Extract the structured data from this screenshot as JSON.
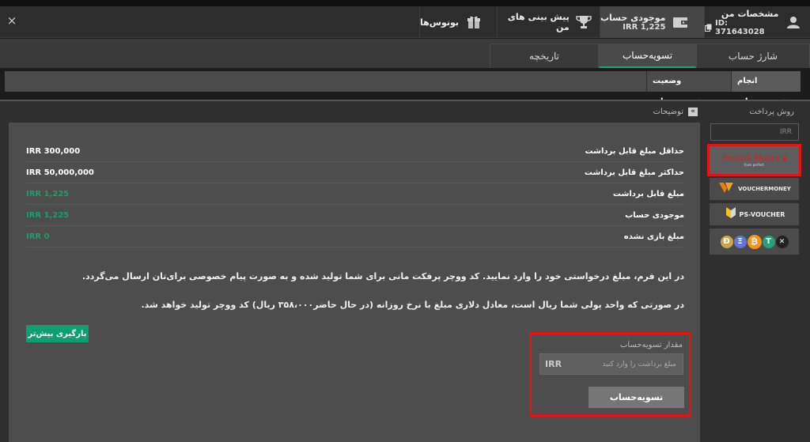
{
  "header": {
    "close_glyph": "×",
    "profile": {
      "title": "مشخصات من",
      "id": "ID: 371643028"
    },
    "balance": {
      "title": "موجودی حساب",
      "amount": "IRR 1,225"
    },
    "predictions": {
      "title": "پیش بینی های من"
    },
    "bonuses": {
      "title": "بونوس‌ها"
    }
  },
  "subtabs": {
    "charge": "شارژ حساب",
    "settle": "تسویه‌حساب",
    "history": "تاریخچه"
  },
  "tabs3": {
    "do_settle": "انجام تسویه‌حساب",
    "status": "وضعیت تسویه‌حساب"
  },
  "payment": {
    "label": "روش پرداخت",
    "currency_field": "IRR",
    "methods": [
      {
        "name": "Perfect Money",
        "tagline": "lives perfect"
      },
      {
        "name": "VOUCHERMONEY"
      },
      {
        "name": "PS-VOUCHER"
      },
      {
        "name": "crypto"
      }
    ],
    "crypto_glyphs": [
      "Đ",
      "Ξ",
      "₿",
      "T",
      "✕"
    ]
  },
  "description": {
    "label": "توضیحات"
  },
  "rows": [
    {
      "label": "حداقل مبلغ قابل برداشت",
      "value": "IRR 300,000",
      "color": "#ffffff"
    },
    {
      "label": "حداکثر مبلغ قابل برداشت",
      "value": "IRR 50,000,000",
      "color": "#ffffff"
    },
    {
      "label": "مبلغ قابل برداشت",
      "value": "IRR 1,225",
      "color": "#1c9e6c"
    },
    {
      "label": "موجودی حساب",
      "value": "IRR 1,225",
      "color": "#1c9e6c"
    },
    {
      "label": "مبلغ بازی نشده",
      "value": "IRR 0",
      "color": "#1c9e6c"
    }
  ],
  "paragraphs": [
    "در این فرم، مبلغ درخواستی خود را وارد نمایید. کد ووچر پرفکت مانی برای شما تولید شده و به صورت پیام خصوصی برای‌تان ارسال می‌گردد.",
    "در صورتی که واحد پولی شما ریال است، معادل دلاری مبلغ با نرخ روزانه (در حال حاضر۳۵۸،۰۰۰ ریال) کد ووچر تولید خواهد شد."
  ],
  "load_more": "بارگیری بیش‌تر",
  "settle": {
    "label": "مقدار تسویه‌حساب",
    "placeholder": "مبلغ برداشت را وارد کنید",
    "currency": "IRR",
    "button": "تسویه‌حساب"
  },
  "colors": {
    "accent": "#1aa57b",
    "highlight": "#e01414"
  }
}
